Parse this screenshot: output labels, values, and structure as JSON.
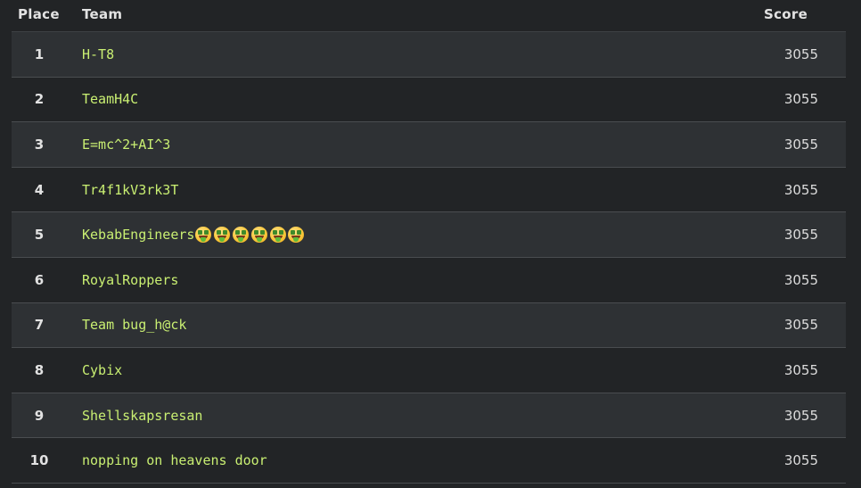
{
  "table": {
    "headers": {
      "place": "Place",
      "team": "Team",
      "score": "Score"
    },
    "rows": [
      {
        "place": "1",
        "team": "H-T8",
        "score": "3055"
      },
      {
        "place": "2",
        "team": "TeamH4C",
        "score": "3055"
      },
      {
        "place": "3",
        "team": "E=mc^2+AI^3",
        "score": "3055"
      },
      {
        "place": "4",
        "team": "Tr4f1kV3rk3T",
        "score": "3055"
      },
      {
        "place": "5",
        "team": "KebabEngineers",
        "score": "3055",
        "emoji": "money-mouth-face",
        "emoji_count": 6
      },
      {
        "place": "6",
        "team": "RoyalRoppers",
        "score": "3055"
      },
      {
        "place": "7",
        "team": "Team bug_h@ck",
        "score": "3055"
      },
      {
        "place": "8",
        "team": "Cybix",
        "score": "3055"
      },
      {
        "place": "9",
        "team": "Shellskapsresan",
        "score": "3055"
      },
      {
        "place": "10",
        "team": "nopping on heavens door",
        "score": "3055"
      }
    ]
  },
  "colors": {
    "background": "#222426",
    "row_alt": "#2e3134",
    "team_link": "#c9ef72",
    "text": "#e2e2e2",
    "divider": "#4a4d50"
  }
}
